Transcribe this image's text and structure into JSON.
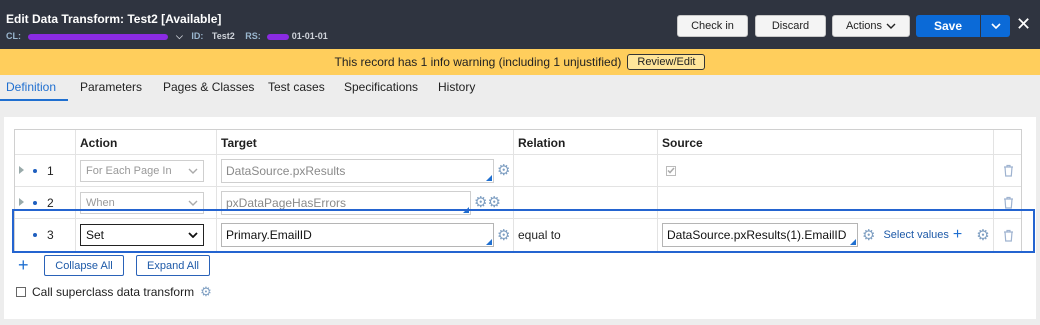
{
  "header": {
    "title": "Edit  Data Transform: Test2 [Available]",
    "class_label": "CL:",
    "id_label": "ID:",
    "id_value": "Test2",
    "rs_label": "RS:",
    "rs_value": "01-01-01",
    "buttons": {
      "check_in": "Check in",
      "discard": "Discard",
      "actions": "Actions",
      "save": "Save"
    }
  },
  "warning": {
    "text": "This record has 1 info warning (including 1 unjustified)",
    "button": "Review/Edit"
  },
  "tabs": [
    "Definition",
    "Parameters",
    "Pages & Classes",
    "Test cases",
    "Specifications",
    "History"
  ],
  "grid": {
    "columns": {
      "action": "Action",
      "target": "Target",
      "relation": "Relation",
      "source": "Source"
    },
    "rows": [
      {
        "num": "1",
        "action": "For Each Page In",
        "target": "DataSource.pxResults",
        "relation": "",
        "source": ""
      },
      {
        "num": "2",
        "action": "When",
        "target": "pxDataPageHasErrors",
        "relation": "",
        "source": ""
      },
      {
        "num": "3",
        "action": "Set",
        "target": "Primary.EmailID",
        "relation": "equal to",
        "source": "DataSource.pxResults(1).EmailID",
        "select_values": "Select values"
      }
    ]
  },
  "buttons": {
    "collapse_all": "Collapse All",
    "expand_all": "Expand All"
  },
  "superclass_label": "Call superclass data transform",
  "colors": {
    "header_bg": "#2f3440",
    "warning_bg": "#ffce5c",
    "accent": "#1f6fd0",
    "save": "#0b6ad7",
    "redaction": "#8a2be2"
  }
}
